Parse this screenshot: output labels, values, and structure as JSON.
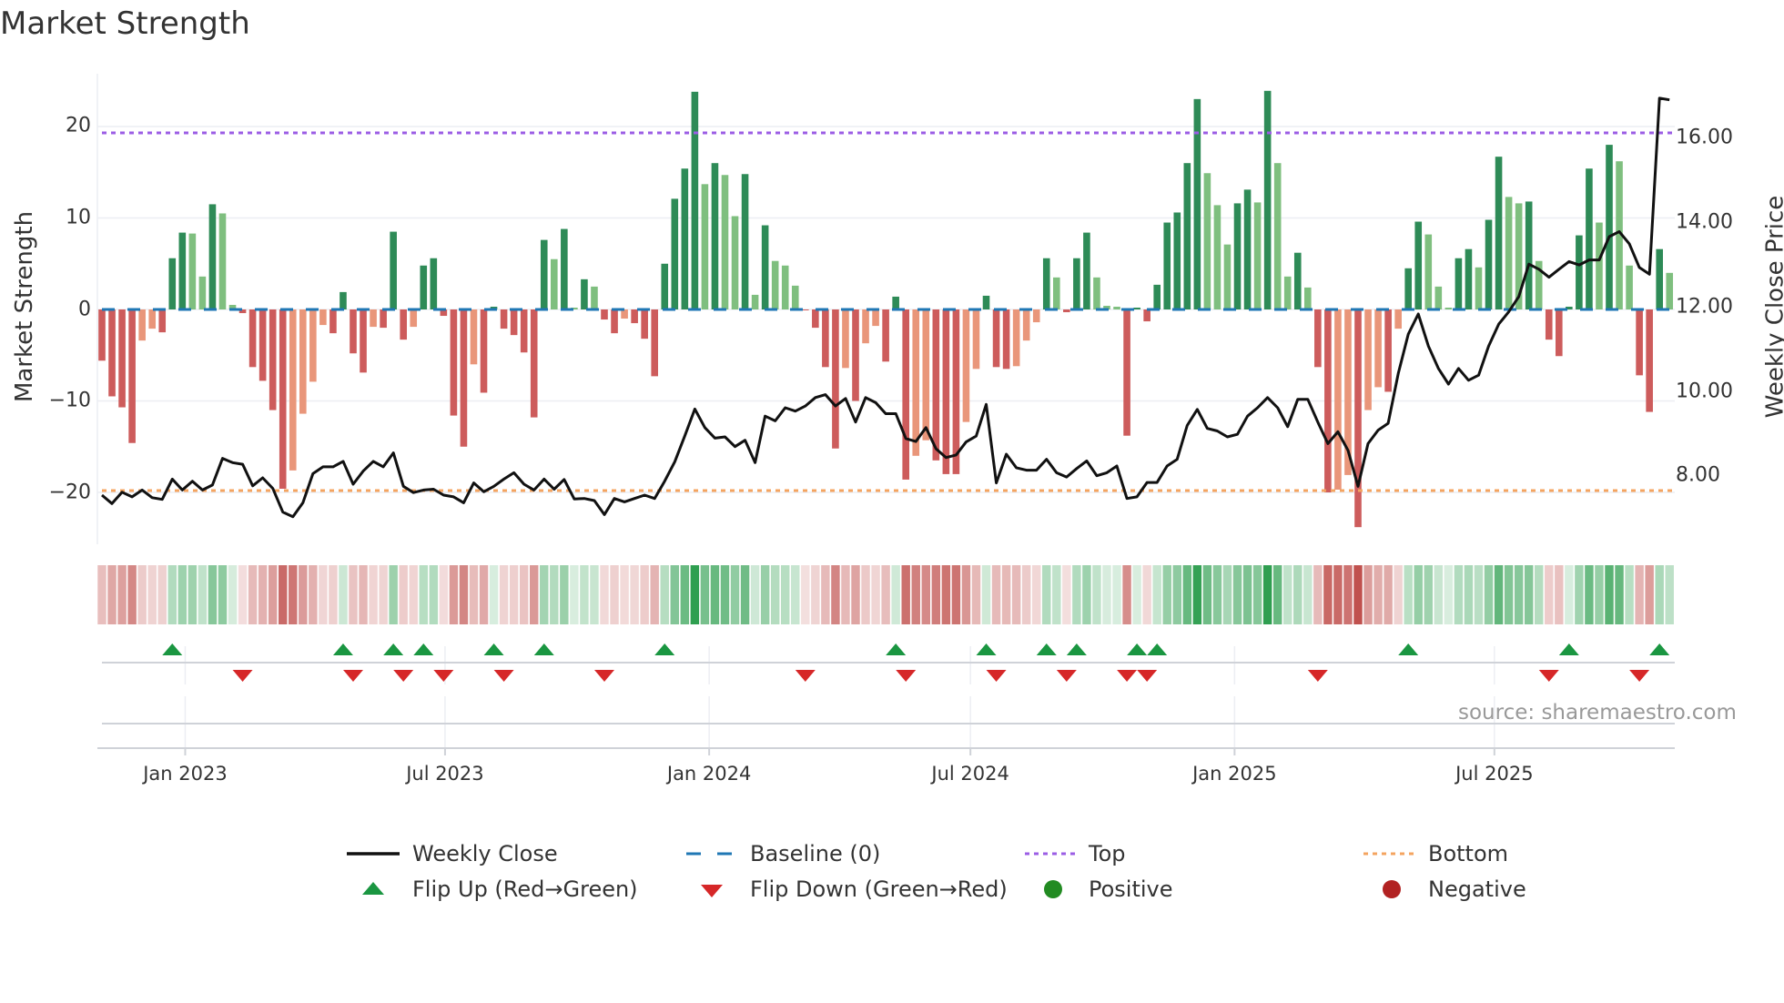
{
  "title": "Market Strength",
  "source": "source: sharemaestro.com",
  "legend": {
    "weekly_close": "Weekly Close",
    "baseline": "Baseline (0)",
    "top": "Top",
    "bottom": "Bottom",
    "flip_up": "Flip Up (Red→Green)",
    "flip_down": "Flip Down (Green→Red)",
    "positive": "Positive",
    "negative": "Negative"
  },
  "colors": {
    "strong_green": "#2e8b57",
    "weak_green": "#7fbf7f",
    "strong_red": "#cd5c5c",
    "weak_red": "#e9967a",
    "close_line": "#111111",
    "baseline": "#1f77b4",
    "top": "#9b5de5",
    "bottom": "#f4a460",
    "flip_up": "#1a9641",
    "flip_down": "#d62728",
    "positive": "#228b22",
    "negative": "#b22222"
  },
  "chart_data": {
    "type": "bar",
    "title": "Market Strength",
    "ylabel": "Market Strength",
    "y2label": "Weekly Close Price",
    "ylim": [
      -27,
      27
    ],
    "y_ticks": [
      {
        "v": 20,
        "label": "20"
      },
      {
        "v": 10,
        "label": "10"
      },
      {
        "v": 0,
        "label": "0"
      },
      {
        "v": -10,
        "label": "−10"
      },
      {
        "v": -20,
        "label": "−20"
      }
    ],
    "y2_ticks": [
      {
        "v": 16,
        "label": "16.00"
      },
      {
        "v": 14,
        "label": "14.00"
      },
      {
        "v": 12,
        "label": "12.00"
      },
      {
        "v": 10,
        "label": "10.00"
      },
      {
        "v": 8,
        "label": "8.00"
      }
    ],
    "x_start": "2022-11-04",
    "x_freq": "weekly",
    "x_ticks": [
      {
        "date": "2023-01-01",
        "label": "Jan 2023"
      },
      {
        "date": "2023-07-01",
        "label": "Jul 2023"
      },
      {
        "date": "2024-01-01",
        "label": "Jan 2024"
      },
      {
        "date": "2024-07-01",
        "label": "Jul 2024"
      },
      {
        "date": "2025-01-01",
        "label": "Jan 2025"
      },
      {
        "date": "2025-07-01",
        "label": "Jul 2025"
      }
    ],
    "top_level": 19.3,
    "bottom_level": -19.8,
    "baseline": 0,
    "strength": [
      -5.6,
      -9.5,
      -10.7,
      -14.6,
      -3.4,
      -2.1,
      -2.5,
      5.6,
      8.4,
      8.3,
      3.6,
      11.5,
      10.5,
      0.5,
      -0.4,
      -6.3,
      -7.8,
      -11,
      -19.6,
      -17.6,
      -11.4,
      -7.9,
      -1.7,
      -2.6,
      1.9,
      -4.8,
      -6.9,
      -1.9,
      -2.0,
      8.5,
      -3.3,
      -1.9,
      4.8,
      5.6,
      -0.7,
      -11.6,
      -15,
      -6,
      -9.1,
      0.3,
      -2.1,
      -2.8,
      -4.7,
      -11.8,
      7.6,
      5.5,
      8.8,
      0.2,
      3.3,
      2.5,
      -1.1,
      -2.6,
      -1.0,
      -1.5,
      -3.2,
      -7.3,
      5.0,
      12.1,
      15.4,
      23.8,
      13.7,
      16.0,
      14.7,
      10.2,
      14.8,
      1.6,
      9.2,
      5.3,
      4.8,
      2.6,
      -0.1,
      -2.0,
      -6.3,
      -15.2,
      -6.4,
      -10.0,
      -3.7,
      -1.8,
      -5.7,
      1.4,
      -18.6,
      -16.0,
      -14.3,
      -16.5,
      -18.0,
      -18.0,
      -12.3,
      -6.5,
      1.5,
      -6.3,
      -6.5,
      -6.2,
      -3.4,
      -1.4,
      5.6,
      3.5,
      -0.3,
      5.6,
      8.4,
      3.5,
      0.4,
      0.3,
      -13.8,
      0.2,
      -1.3,
      2.7,
      9.5,
      10.6,
      16.0,
      23.0,
      14.9,
      11.4,
      7.1,
      11.6,
      13.1,
      11.7,
      23.9,
      16.0,
      3.6,
      6.2,
      2.4,
      -6.3,
      -20.0,
      -19.7,
      -18.1,
      -23.8,
      -11.0,
      -8.5,
      -9.0,
      -2.1,
      4.5,
      9.6,
      8.2,
      2.5,
      0.2,
      5.6,
      6.6,
      4.6,
      9.8,
      16.7,
      12.3,
      11.6,
      11.8,
      5.3,
      -3.3,
      -5.1,
      0.3,
      8.1,
      15.4,
      9.5,
      18.0,
      16.2,
      4.8,
      -7.2,
      -11.2,
      6.6,
      4.0
    ],
    "weekly_close": [
      7.56,
      7.36,
      7.63,
      7.52,
      7.68,
      7.5,
      7.46,
      7.94,
      7.68,
      7.89,
      7.68,
      7.8,
      8.43,
      8.33,
      8.29,
      7.78,
      7.97,
      7.72,
      7.16,
      7.05,
      7.38,
      8.07,
      8.23,
      8.23,
      8.36,
      7.82,
      8.13,
      8.36,
      8.23,
      8.56,
      7.77,
      7.62,
      7.68,
      7.7,
      7.56,
      7.52,
      7.38,
      7.85,
      7.64,
      7.77,
      7.94,
      8.09,
      7.82,
      7.68,
      7.94,
      7.7,
      7.93,
      7.47,
      7.48,
      7.43,
      7.1,
      7.48,
      7.4,
      7.48,
      7.56,
      7.48,
      7.89,
      8.35,
      8.96,
      9.6,
      9.16,
      8.91,
      8.94,
      8.71,
      8.86,
      8.33,
      9.43,
      9.32,
      9.63,
      9.55,
      9.67,
      9.87,
      9.94,
      9.67,
      9.85,
      9.29,
      9.87,
      9.75,
      9.49,
      9.49,
      8.9,
      8.83,
      9.16,
      8.66,
      8.45,
      8.51,
      8.82,
      8.96,
      9.71,
      7.85,
      8.53,
      8.21,
      8.15,
      8.15,
      8.41,
      8.09,
      7.99,
      8.19,
      8.37,
      8.02,
      8.09,
      8.25,
      7.48,
      7.52,
      7.86,
      7.86,
      8.25,
      8.41,
      9.21,
      9.59,
      9.14,
      9.08,
      8.94,
      9.0,
      9.43,
      9.63,
      9.87,
      9.63,
      9.18,
      9.83,
      9.83,
      9.29,
      8.78,
      9.06,
      8.62,
      7.77,
      8.78,
      9.1,
      9.26,
      10.44,
      11.37,
      11.85,
      11.09,
      10.56,
      10.19,
      10.56,
      10.28,
      10.4,
      11.09,
      11.61,
      11.9,
      12.26,
      13.03,
      12.91,
      12.72,
      12.91,
      13.09,
      13.01,
      13.13,
      13.13,
      13.68,
      13.8,
      13.51,
      12.95,
      12.79,
      16.96,
      16.92
    ]
  }
}
